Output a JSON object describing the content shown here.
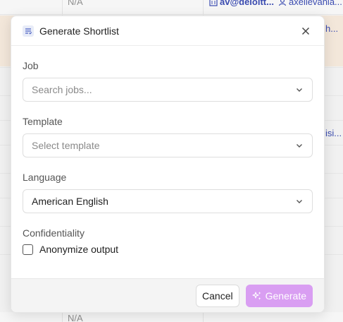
{
  "background": {
    "top_na": "N/A",
    "top_email": "av@deloitt...",
    "top_user": "axellevania...",
    "row1_cut": "h...",
    "row3_cut": "isi...",
    "bottom_na": "N/A"
  },
  "modal": {
    "title": "Generate Shortlist",
    "fields": {
      "job": {
        "label": "Job",
        "placeholder": "Search jobs..."
      },
      "template": {
        "label": "Template",
        "placeholder": "Select template"
      },
      "language": {
        "label": "Language",
        "value": "American English"
      }
    },
    "confidentiality": {
      "label": "Confidentiality",
      "checkbox_label": "Anonymize output",
      "checked": false
    },
    "footer": {
      "cancel_label": "Cancel",
      "generate_label": "Generate"
    }
  },
  "colors": {
    "accent_generate": "#d99ef2",
    "highlight_row": "#f3e7da",
    "link": "#3a4bb0"
  },
  "icons": [
    "list-icon",
    "close-icon",
    "chevron-down-icon",
    "sparkle-icon",
    "building-icon",
    "user-icon"
  ]
}
